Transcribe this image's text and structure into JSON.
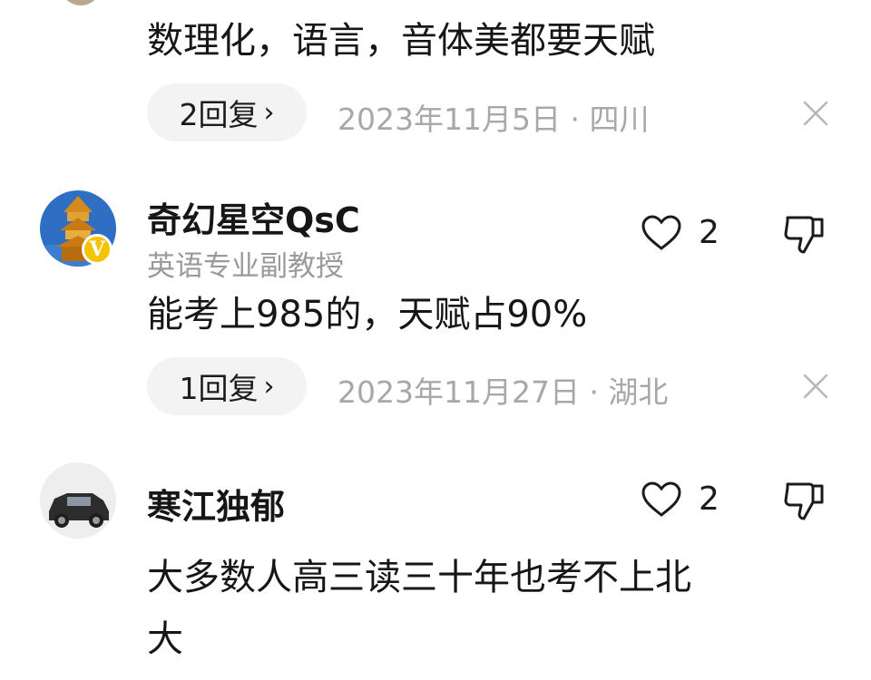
{
  "comments": [
    {
      "text": "数理化，语言，音体美都要天赋",
      "reply_label": "2回复",
      "meta": "2023年11月5日 · 四川"
    },
    {
      "username": "奇幻星空QsC",
      "subtitle": "英语专业副教授",
      "likes": "2",
      "text": "能考上985的，天赋占90%",
      "reply_label": "1回复",
      "meta": "2023年11月27日 · 湖北",
      "badge": "V"
    },
    {
      "username": "寒江独郁",
      "likes": "2",
      "text_line1": "大多数人高三读三十年也考不上北",
      "text_line2": "大"
    }
  ],
  "icons": {
    "reply_chevron": "chevron-right-icon",
    "close": "close-icon",
    "like": "heart-outline-icon",
    "dislike": "thumbs-down-icon"
  },
  "colors": {
    "badge": "#f5c400",
    "pill_bg": "#f3f3f3",
    "meta_text": "#a8a8a8"
  }
}
